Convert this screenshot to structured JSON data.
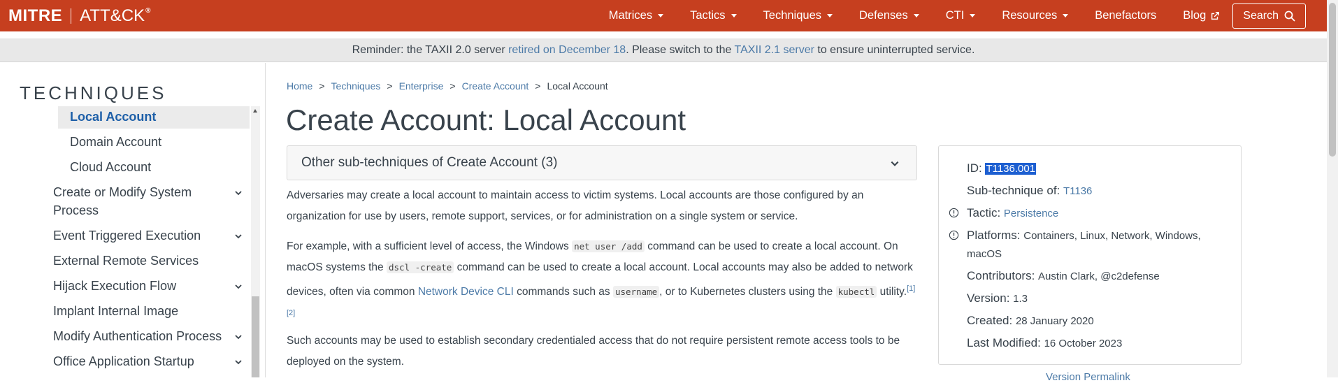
{
  "nav": {
    "brand_mitre": "MITRE",
    "brand_attack": "ATT&CK",
    "brand_reg": "®",
    "items": [
      {
        "label": "Matrices"
      },
      {
        "label": "Tactics"
      },
      {
        "label": "Techniques"
      },
      {
        "label": "Defenses"
      },
      {
        "label": "CTI"
      },
      {
        "label": "Resources"
      },
      {
        "label": "Benefactors"
      },
      {
        "label": "Blog"
      }
    ],
    "search_label": "Search"
  },
  "banner": {
    "pre": "Reminder: the TAXII 2.0 server ",
    "link1": "retired on December 18",
    "mid": ". Please switch to the ",
    "link2": "TAXII 2.1 server",
    "post": " to ensure uninterrupted service."
  },
  "sidebar": {
    "title": "TECHNIQUES",
    "items": [
      {
        "label": "Local Account"
      },
      {
        "label": "Domain Account"
      },
      {
        "label": "Cloud Account"
      },
      {
        "label": "Create or Modify System"
      },
      {
        "label": "Process"
      },
      {
        "label": "Event Triggered Execution"
      },
      {
        "label": "External Remote Services"
      },
      {
        "label": "Hijack Execution Flow"
      },
      {
        "label": "Implant Internal Image"
      },
      {
        "label": "Modify Authentication Process"
      },
      {
        "label": "Office Application Startup"
      }
    ]
  },
  "breadcrumb": [
    "Home",
    "Techniques",
    "Enterprise",
    "Create Account",
    "Local Account"
  ],
  "breadcrumb_sep": ">",
  "title": "Create Account: Local Account",
  "subtech_label": "Other sub-techniques of Create Account (3)",
  "desc": {
    "p1": "Adversaries may create a local account to maintain access to victim systems. Local accounts are those configured by an organization for use by users, remote support, services, or for administration on a single system or service.",
    "p2_a": "For example, with a sufficient level of access, the Windows ",
    "p2_code1": "net user /add",
    "p2_b": " command can be used to create a local account. On macOS systems the ",
    "p2_code2": "dscl -create",
    "p2_c": " command can be used to create a local account. Local accounts may also be added to network devices, often via common ",
    "p2_link": "Network Device CLI",
    "p2_d": " commands such as ",
    "p2_code3": "username",
    "p2_e": ", or to Kubernetes clusters using the ",
    "p2_code4": "kubectl",
    "p2_f": " utility.",
    "p2_ref": "[1][2]",
    "p3": "Such accounts may be used to establish secondary credentialed access that do not require persistent remote access tools to be deployed on the system."
  },
  "card": {
    "id_label": "ID: ",
    "id_value": "T1136.001",
    "sub_label": "Sub-technique of: ",
    "sub_value": "T1136",
    "tactic_label": "Tactic: ",
    "tactic_value": "Persistence",
    "platforms_label": "Platforms: ",
    "platforms_value": "Containers, Linux, Network, Windows,",
    "platforms_value2": "macOS",
    "contributors_label": "Contributors: ",
    "contributors_value": "Austin Clark, @c2defense",
    "version_label": "Version: ",
    "version_value": "1.3",
    "created_label": "Created: ",
    "created_value": "28 January 2020",
    "modified_label": "Last Modified: ",
    "modified_value": "16 October 2023"
  },
  "permalink": "Version Permalink"
}
